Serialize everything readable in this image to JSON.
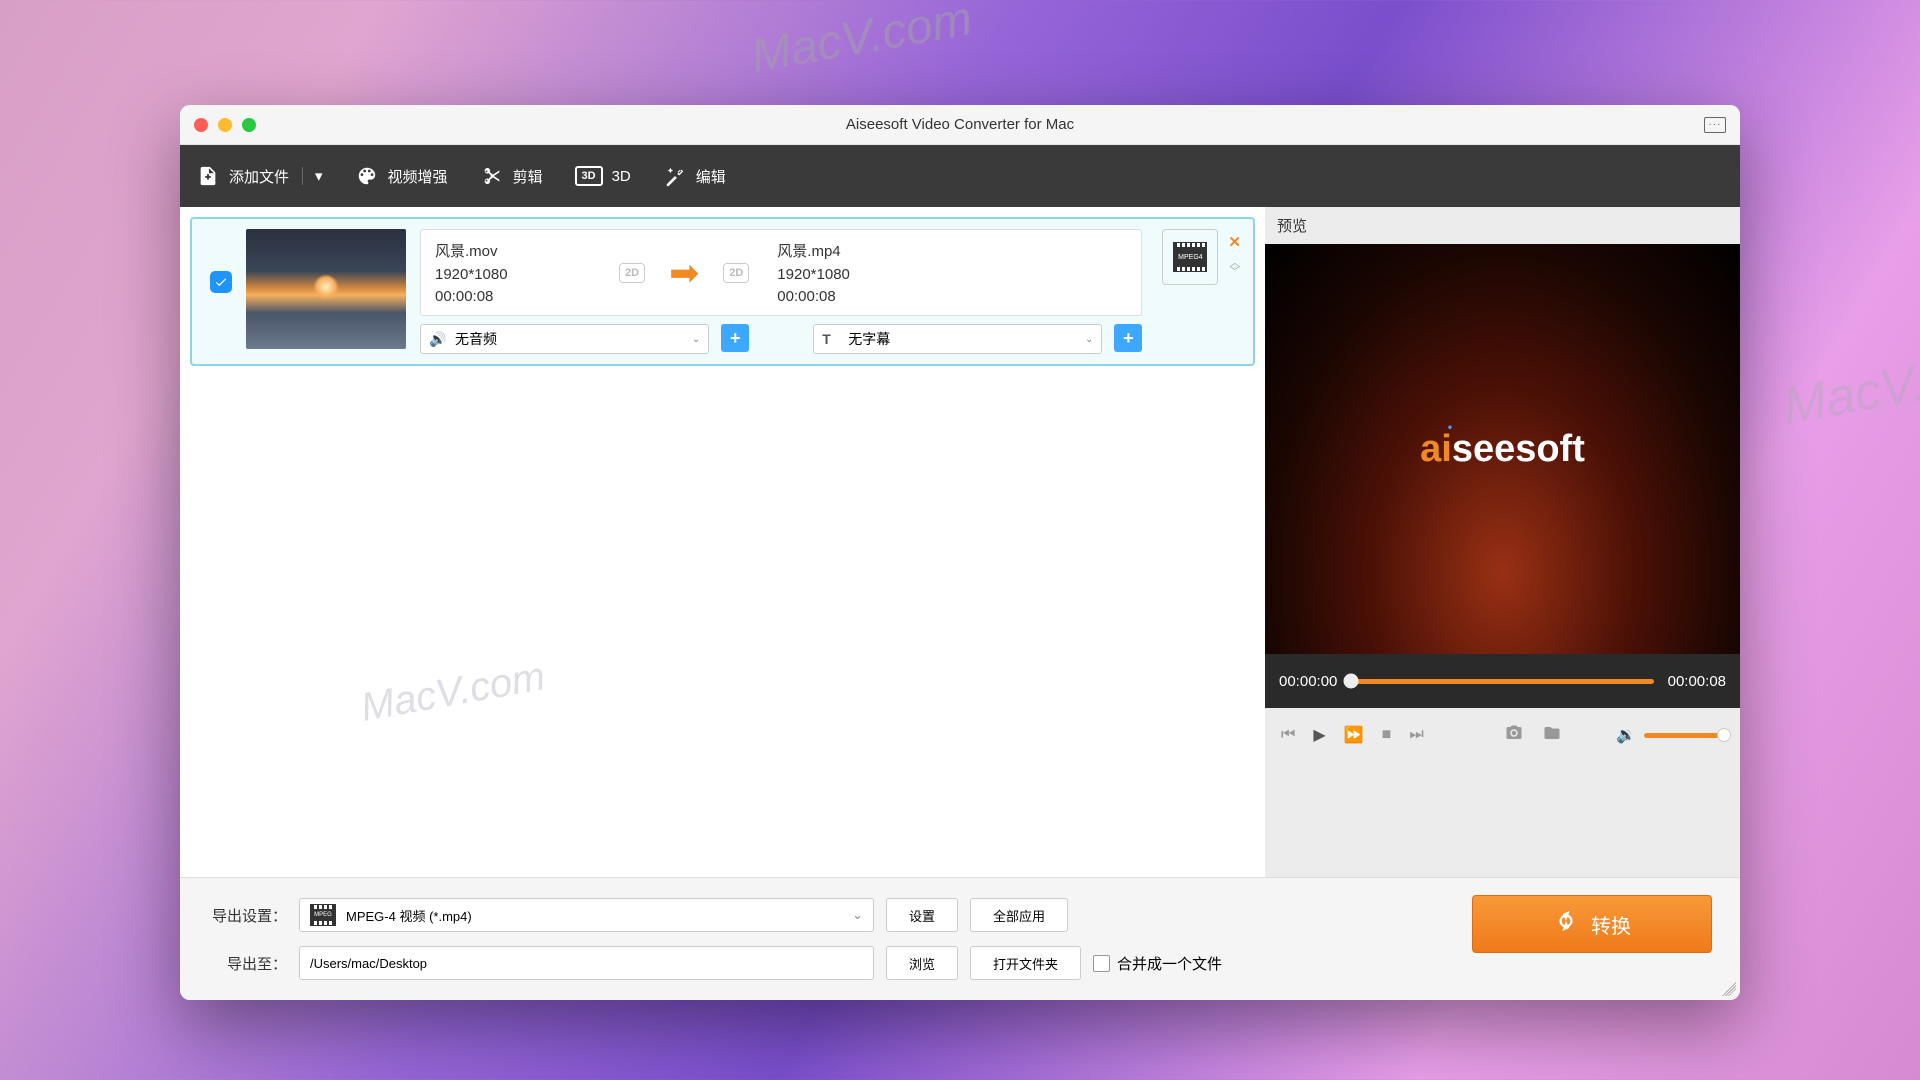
{
  "watermarks": {
    "w1": "MacV.com",
    "w2": "MacV.co",
    "w3": "MacV.com"
  },
  "window": {
    "title": "Aiseesoft Video Converter for Mac"
  },
  "toolbar": {
    "add_file": "添加文件",
    "enhance": "视频增强",
    "cut": "剪辑",
    "threeD": "3D",
    "edit": "编辑"
  },
  "item": {
    "source": {
      "name": "风景.mov",
      "resolution": "1920*1080",
      "duration": "00:00:08",
      "dim": "2D"
    },
    "target": {
      "name": "风景.mp4",
      "resolution": "1920*1080",
      "duration": "00:00:08",
      "dim": "2D"
    },
    "audio_label": "无音频",
    "subtitle_label": "无字幕",
    "format_badge": "MPEG4"
  },
  "preview": {
    "title": "预览",
    "brand_ai": "ai",
    "brand_rest": "seesoft",
    "time_start": "00:00:00",
    "time_end": "00:00:08"
  },
  "footer": {
    "profile_label": "导出设置：",
    "profile_value": "MPEG-4 视频 (*.mp4)",
    "profile_badge": "MPEG",
    "settings_btn": "设置",
    "apply_all_btn": "全部应用",
    "dest_label": "导出至：",
    "dest_value": "/Users/mac/Desktop",
    "browse_btn": "浏览",
    "open_btn": "打开文件夹",
    "merge_label": "合并成一个文件",
    "convert_btn": "转换"
  }
}
